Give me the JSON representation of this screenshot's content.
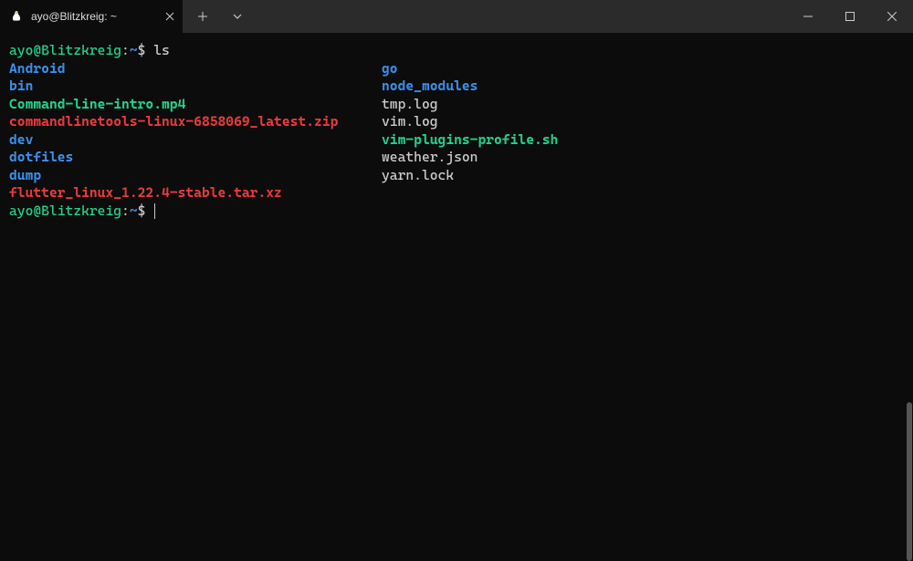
{
  "titlebar": {
    "tab_title": "ayo@Blitzkreig: ~"
  },
  "prompt": {
    "user_host": "ayo@Blitzkreig",
    "separator": ":",
    "path": "~",
    "symbol": "$"
  },
  "command": "ls",
  "ls": {
    "col1": [
      {
        "name": "Android",
        "cls": "ls-dir"
      },
      {
        "name": "bin",
        "cls": "ls-dir"
      },
      {
        "name": "Command-line-intro.mp4",
        "cls": "ls-exec"
      },
      {
        "name": "commandlinetools-linux-6858069_latest.zip",
        "cls": "ls-archive"
      },
      {
        "name": "dev",
        "cls": "ls-dir"
      },
      {
        "name": "dotfiles",
        "cls": "ls-dir"
      },
      {
        "name": "dump",
        "cls": "ls-dir"
      },
      {
        "name": "flutter_linux_1.22.4-stable.tar.xz",
        "cls": "ls-archive"
      }
    ],
    "col2": [
      {
        "name": "go",
        "cls": "ls-dir"
      },
      {
        "name": "node_modules",
        "cls": "ls-dir"
      },
      {
        "name": "tmp.log",
        "cls": "ls-file"
      },
      {
        "name": "vim.log",
        "cls": "ls-file"
      },
      {
        "name": "vim-plugins-profile.sh",
        "cls": "ls-exec"
      },
      {
        "name": "weather.json",
        "cls": "ls-file"
      },
      {
        "name": "yarn.lock",
        "cls": "ls-file"
      }
    ]
  }
}
